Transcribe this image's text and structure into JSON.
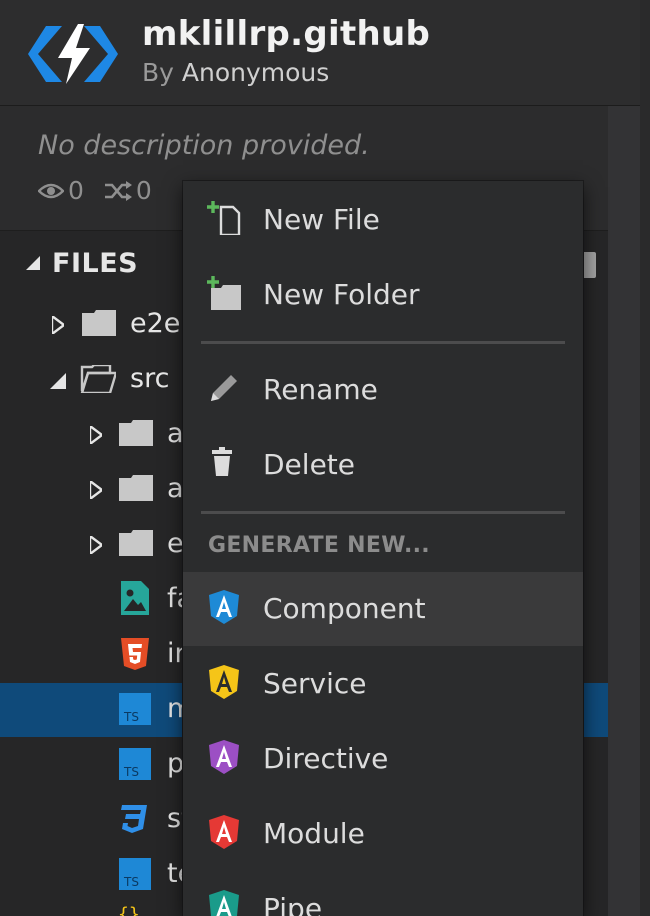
{
  "project": {
    "title": "mklillrp.github",
    "by_prefix": "By",
    "author": "Anonymous",
    "description": "No description provided.",
    "views": "0",
    "forks": "0"
  },
  "files": {
    "heading": "FILES",
    "tree": [
      {
        "label": "e2e",
        "type": "folder",
        "expanded": false
      },
      {
        "label": "src",
        "type": "folder",
        "expanded": true
      },
      {
        "label": "a",
        "type": "folder",
        "expanded": false
      },
      {
        "label": "a",
        "type": "folder",
        "expanded": false
      },
      {
        "label": "e",
        "type": "folder",
        "expanded": false
      },
      {
        "label": "fa",
        "type": "image-file"
      },
      {
        "label": "in",
        "type": "html-file"
      },
      {
        "label": "m",
        "type": "ts-file",
        "selected": true
      },
      {
        "label": "p",
        "type": "ts-file"
      },
      {
        "label": "st",
        "type": "css-file"
      },
      {
        "label": "te",
        "type": "ts-file"
      }
    ]
  },
  "context_menu": {
    "items": [
      {
        "label": "New File",
        "icon": "new-file-icon"
      },
      {
        "label": "New Folder",
        "icon": "new-folder-icon"
      },
      {
        "label": "Rename",
        "icon": "pencil-icon"
      },
      {
        "label": "Delete",
        "icon": "trash-icon"
      }
    ],
    "generate_heading": "GENERATE NEW...",
    "generate_items": [
      {
        "label": "Component",
        "icon": "angular-icon",
        "color": "#1e8ad6"
      },
      {
        "label": "Service",
        "icon": "angular-icon",
        "color": "#f5c518"
      },
      {
        "label": "Directive",
        "icon": "angular-icon",
        "color": "#9c4fc4"
      },
      {
        "label": "Module",
        "icon": "angular-icon",
        "color": "#e53935"
      },
      {
        "label": "Pipe",
        "icon": "angular-icon",
        "color": "#1a9b8a"
      }
    ]
  },
  "colors": {
    "accent": "#1e88e5",
    "selected_row": "#0f4a7a",
    "add_green": "#5cb85c"
  }
}
